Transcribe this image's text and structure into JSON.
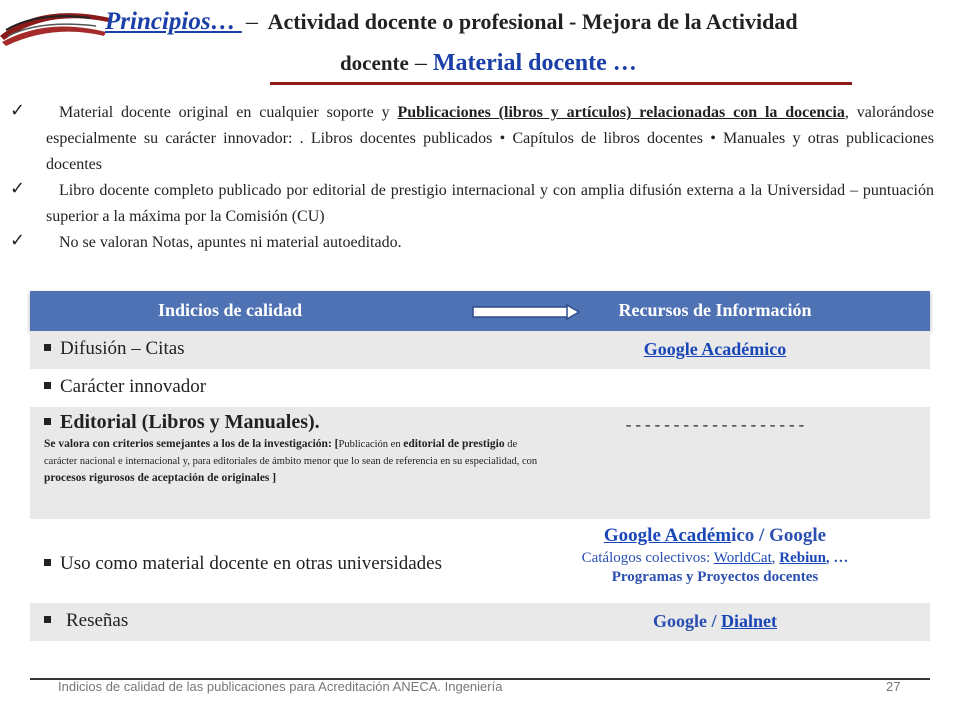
{
  "header": {
    "link_principios": "Principios… ",
    "dash": "–",
    "line1_rest": "Actividad docente o profesional - Mejora de la Actividad",
    "line2_docente": "docente",
    "line2_dash": "–",
    "line2_material": "Material docente …"
  },
  "bullets": [
    {
      "pre": "Material docente original en cualquier soporte y ",
      "highlight": "Publicaciones (libros y artículos) relacionadas con la docencia",
      "post": ", valorándose especialmente su carácter innovador: . Libros docentes publicados  • Capítulos de libros docentes • Manuales y otras publicaciones docentes"
    },
    {
      "text": "Libro docente completo publicado por editorial de prestigio internacional y con amplia difusión externa a la Universidad – puntuación superior a la máxima por la Comisión (CU)"
    },
    {
      "text": "No se valoran Notas, apuntes ni material autoeditado."
    }
  ],
  "table": {
    "header_left": "Indicios de calidad",
    "header_right": "Recursos de Información",
    "rows": [
      {
        "left": "Difusión – Citas",
        "right": "Google  Académico"
      },
      {
        "left": "Carácter innovador",
        "right": ""
      },
      {
        "left": "Editorial (Libros y Manuales).",
        "note_bold": "Se valora con criterios semejantes a los de la investigación: [",
        "note_a": "Publicación en ",
        "note_b": "editorial de prestigio",
        "note_c": " de carácter nacional e internacional y, para editoriales de ámbito menor que lo sean de referencia en su especialidad, con ",
        "note_d": "procesos rigurosos de aceptación de originales ]",
        "right": "-------------------"
      },
      {
        "left": "Uso como material docente en otras universidades",
        "right_ga": "Google Académ",
        "right_ga_rest": "ico  /  Google",
        "cat_label": "Catálogos colectivos: ",
        "worldcat": "WorldCat",
        "comma": ", ",
        "rebiun": "Rebiun",
        "dots": ", …",
        "programas": "Programas y Proyectos docentes"
      },
      {
        "left": "Reseñas",
        "right_google": "Google / ",
        "right_dialnet": "Dialnet"
      }
    ]
  },
  "footer": {
    "text": "Indicios de calidad de las publicaciones para Acreditación ANECA. Ingeniería",
    "page": "27"
  },
  "colors": {
    "accent_blue": "#4f72b5",
    "link_blue": "#1a47b8",
    "rule_red": "#8b1a1a",
    "row_gray": "#e9e9ea"
  }
}
